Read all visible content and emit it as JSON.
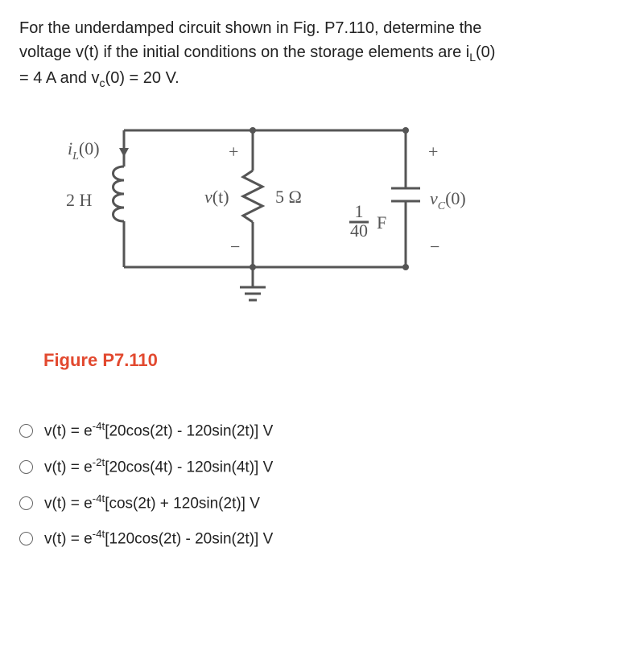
{
  "problem": {
    "line1_prefix": "For the underdamped circuit shown in Fig. P7.110, determine the",
    "line2_prefix": "voltage v(t) if the initial conditions on the storage elements are i",
    "line2_sub1": "L",
    "line2_mid": "(0)",
    "line3_prefix": "= 4 A and v",
    "line3_sub": "c",
    "line3_suffix": "(0) = 20 V."
  },
  "circuit": {
    "iL_label": "i",
    "iL_sub": "L",
    "iL_arg": "(0)",
    "L_label": "2 H",
    "v_label": "v",
    "v_arg": "(t)",
    "R_label": "5 Ω",
    "C_label_num": "1",
    "C_label_den": "40",
    "C_unit": "F",
    "vC_label": "v",
    "vC_sub": "C",
    "vC_arg": "(0)",
    "plus": "+",
    "minus": "−"
  },
  "figure_caption": "Figure P7.110",
  "options": [
    {
      "pre": "v(t) = e",
      "exp": "-4t",
      "post": "[20cos(2t) - 120sin(2t)] V"
    },
    {
      "pre": "v(t) = e",
      "exp": "-2t",
      "post": "[20cos(4t) - 120sin(4t)] V"
    },
    {
      "pre": "v(t) = e",
      "exp": "-4t",
      "post": "[cos(2t) + 120sin(2t)] V"
    },
    {
      "pre": "v(t) = e",
      "exp": "-4t",
      "post": "[120cos(2t) - 20sin(2t)] V"
    }
  ],
  "chart_data": {
    "type": "table",
    "description": "Parallel RLC circuit with inductor (2 H), resistor (5 Ω), capacitor (1/40 F). Initial conditions iL(0)=4 A, vC(0)=20 V. v(t) measured across all parallel elements.",
    "components": [
      {
        "name": "inductor",
        "value": "2 H",
        "initial": "iL(0)=4 A"
      },
      {
        "name": "resistor",
        "value": "5 Ω",
        "measured": "v(t)"
      },
      {
        "name": "capacitor",
        "value": "1/40 F",
        "initial": "vC(0)=20 V"
      }
    ]
  }
}
